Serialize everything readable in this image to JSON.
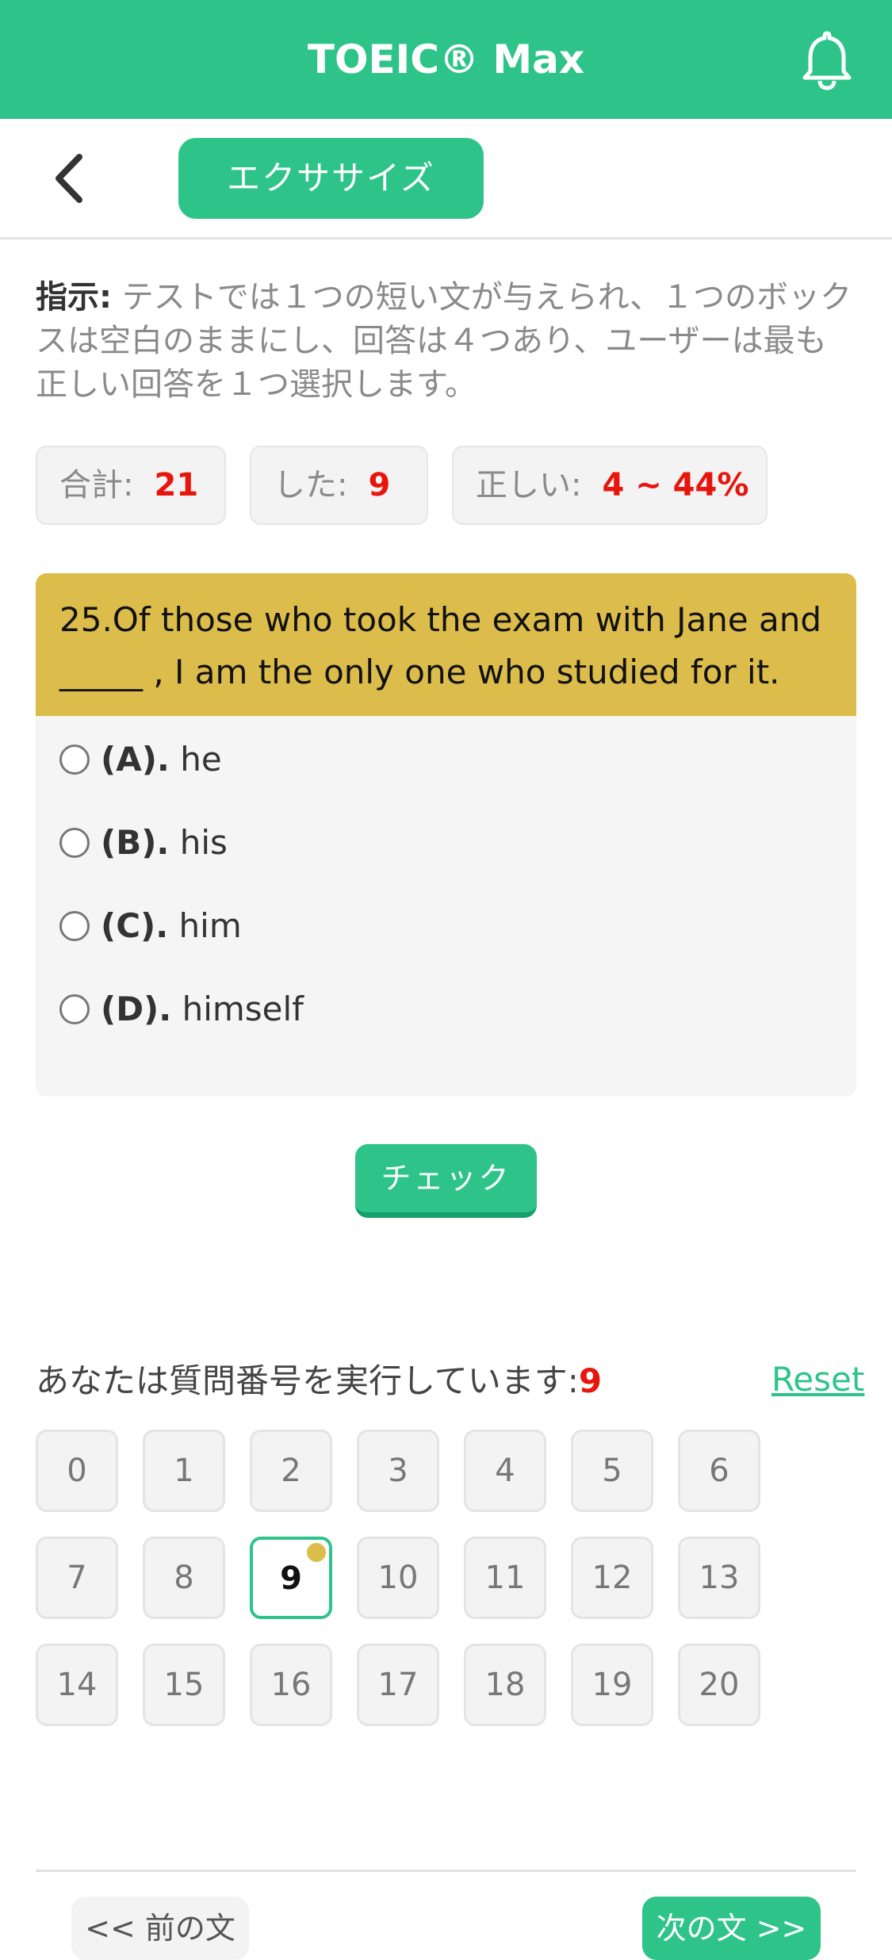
{
  "header": {
    "title": "TOEIC® Max",
    "bell_icon": "bell-icon"
  },
  "subheader": {
    "back_icon": "chevron-left-icon",
    "tab_label": "エクササイズ"
  },
  "instructions": {
    "label": "指示:",
    "text": " テストでは１つの短い文が与えられ、１つのボックスは空白のままにし、回答は４つあり、ユーザーは最も正しい回答を１つ選択します。"
  },
  "stats": {
    "total_label": "合計:",
    "total_value": "21",
    "done_label": "した:",
    "done_value": "9",
    "correct_label": "正しい:",
    "correct_value": "4 ~ 44%"
  },
  "question": {
    "text": "25.Of those who took the exam with Jane and _____ , I am the only one who studied for it.",
    "options": [
      {
        "key": "(A).",
        "text": "he"
      },
      {
        "key": "(B).",
        "text": "his"
      },
      {
        "key": "(C).",
        "text": "him"
      },
      {
        "key": "(D).",
        "text": "himself"
      }
    ]
  },
  "check_label": "チェック",
  "progress": {
    "running_label": "あなたは質問番号を実行しています:",
    "current": "9",
    "reset_label": "Reset",
    "numbers": [
      "0",
      "1",
      "2",
      "3",
      "4",
      "5",
      "6",
      "7",
      "8",
      "9",
      "10",
      "11",
      "12",
      "13",
      "14",
      "15",
      "16",
      "17",
      "18",
      "19",
      "20"
    ]
  },
  "nav": {
    "prev_label": "<< 前の文",
    "next_label": "次の文 >>"
  },
  "colors": {
    "accent": "#2ec489",
    "question_bg": "#dcbd4b",
    "number_red": "#e8150d"
  }
}
